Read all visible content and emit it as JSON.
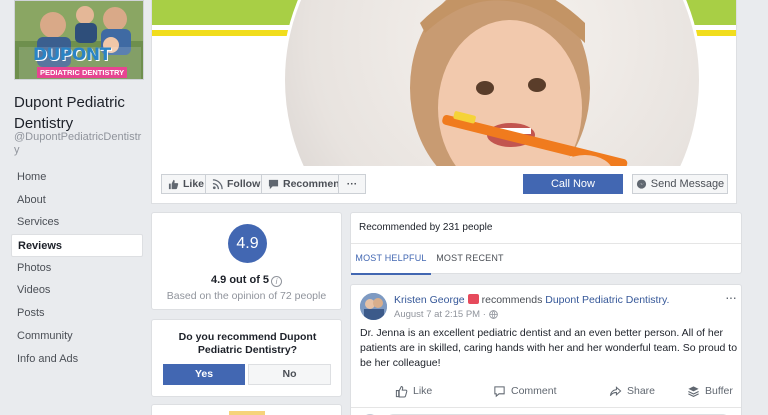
{
  "page": {
    "name": "Dupont Pediatric Dentistry",
    "handle": "@DupontPediatricDentistry",
    "logo_text_top": "DUPONT",
    "logo_text_bottom": "PEDIATRIC DENTISTRY"
  },
  "nav": {
    "items": [
      {
        "label": "Home"
      },
      {
        "label": "About"
      },
      {
        "label": "Services"
      },
      {
        "label": "Reviews",
        "active": true
      },
      {
        "label": "Photos"
      },
      {
        "label": "Videos"
      },
      {
        "label": "Posts"
      },
      {
        "label": "Community"
      },
      {
        "label": "Info and Ads"
      }
    ]
  },
  "actions": {
    "like": "Like",
    "follow": "Follow",
    "recommend": "Recommend",
    "more": "···",
    "call_now": "Call Now",
    "send_message": "Send Message"
  },
  "rating": {
    "score": "4.9",
    "out_of": "4.9 out of 5",
    "basis": "Based on the opinion of 72 people"
  },
  "recommend_prompt": {
    "question": "Do you recommend Dupont Pediatric Dentistry?",
    "yes": "Yes",
    "no": "No"
  },
  "reviews": {
    "recommended_by": "Recommended by 231 people",
    "tabs": [
      {
        "label": "MOST HELPFUL",
        "active": true
      },
      {
        "label": "MOST RECENT",
        "active": false
      }
    ]
  },
  "review": {
    "author": "Kristen George",
    "verb": "recommends",
    "target": "Dupont Pediatric Dentistry.",
    "date": "August 7 at 2:15 PM ·",
    "text": "Dr. Jenna is an excellent pediatric dentist and an even better person. All of her patients are in skilled, caring hands with her and her wonderful team. So proud to be her colleague!",
    "more": "···",
    "actions": {
      "like": "Like",
      "comment": "Comment",
      "share": "Share",
      "buffer": "Buffer"
    }
  },
  "colors": {
    "accent": "#4267b2",
    "link": "#365899",
    "cover_green": "#a8cf45",
    "cover_yellow": "#f1dd1d",
    "background": "#e9ebee"
  }
}
